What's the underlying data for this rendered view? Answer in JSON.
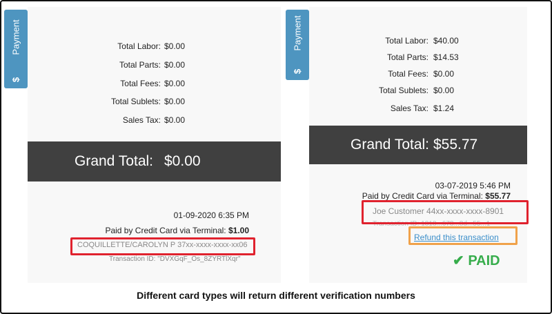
{
  "left": {
    "tab": {
      "label": "Payment",
      "icon": "$"
    },
    "rows": [
      {
        "label": "Total Labor:",
        "value": "$0.00"
      },
      {
        "label": "Total Parts:",
        "value": "$0.00"
      },
      {
        "label": "Total Fees:",
        "value": "$0.00"
      },
      {
        "label": "Total Sublets:",
        "value": "$0.00"
      },
      {
        "label": "Sales Tax:",
        "value": "$0.00"
      }
    ],
    "grand_total": {
      "label": "Grand Total:",
      "value": "$0.00"
    },
    "payment": {
      "datetime": "01-09-2020 6:35 PM",
      "paid_by": "Paid by Credit Card via Terminal:",
      "amount": "$1.00",
      "card": "COQUILLETTE/CAROLYN P  37xx-xxxx-xxxx-xx06",
      "transaction": "Transaction ID: \"DVXGqF_Os_8ZYRTlXqr\""
    }
  },
  "right": {
    "tab": {
      "label": "Payment",
      "icon": "$"
    },
    "rows": [
      {
        "label": "Total Labor:",
        "value": "$40.00"
      },
      {
        "label": "Total Parts:",
        "value": "$14.53"
      },
      {
        "label": "Total Fees:",
        "value": "$0.00"
      },
      {
        "label": "Total Sublets:",
        "value": "$0.00"
      },
      {
        "label": "Sales Tax:",
        "value": "$1.24"
      }
    ],
    "grand_total": {
      "label": "Grand Total:",
      "value": "$55.77"
    },
    "payment": {
      "datetime": "03-07-2019 5:46 PM",
      "paid_by": "Paid by Credit Card via Terminal:",
      "amount": "$55.77",
      "card": "Joe Customer 44xx-xxxx-xxxx-8901",
      "transaction": "Transaction ID: 1818...678...8d...55...1",
      "refund_link": "Refund this transaction",
      "paid_label": "PAID",
      "paid_icon": "✔"
    }
  },
  "caption": "Different card types will return different verification numbers",
  "colors": {
    "tab": "#4e95c0",
    "grand_bg": "#404040",
    "highlight_red": "#e0222e",
    "highlight_orange": "#f0a24a",
    "paid_green": "#37ad4c"
  }
}
